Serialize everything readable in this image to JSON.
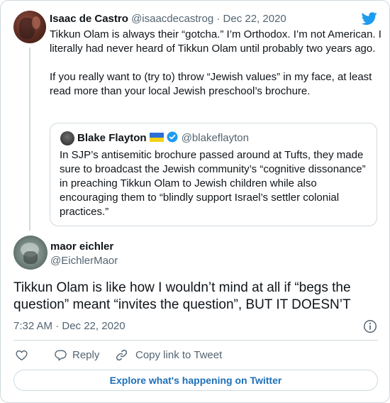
{
  "parent_tweet": {
    "name": "Isaac de Castro",
    "handle": "@isaacdecastrog",
    "separator": "·",
    "date": "Dec 22, 2020",
    "paragraphs": [
      "Tikkun Olam is always their “gotcha.” I’m Orthodox. I’m not American. I literally had never heard of Tikkun Olam until probably two years ago.",
      "If you really want to (try to) throw “Jewish values” in my face, at least read more than your local Jewish preschool’s brochure."
    ]
  },
  "quoted_tweet": {
    "name": "Blake Flayton",
    "handle": "@blakeflayton",
    "text": "In SJP’s antisemitic brochure passed around at Tufts, they made sure to broadcast the Jewish community’s “cognitive dissonance” in preaching Tikkun Olam to Jewish children while also encouraging them to “blindly support Israel’s settler colonial practices.”",
    "flag_colors": [
      "#2b6fd6",
      "#f7d117"
    ],
    "verified_color": "#1d9bf0"
  },
  "main_tweet": {
    "name": "maor eichler",
    "handle": "@EichlerMaor",
    "text": "Tikkun Olam is like how I wouldn’t mind at all if “begs the question” meant “invites the question”, BUT IT DOESN’T",
    "timestamp": "7:32 AM · Dec 22, 2020"
  },
  "actions": {
    "like_icon": "heart-icon",
    "reply_label": "Reply",
    "copy_link_label": "Copy link to Tweet"
  },
  "explore_label": "Explore what's happening on Twitter",
  "colors": {
    "brand": "#1d9bf0",
    "text": "#0f1419",
    "muted": "#536471",
    "border": "#cfd9de",
    "explore_link": "#1d6fb8"
  }
}
